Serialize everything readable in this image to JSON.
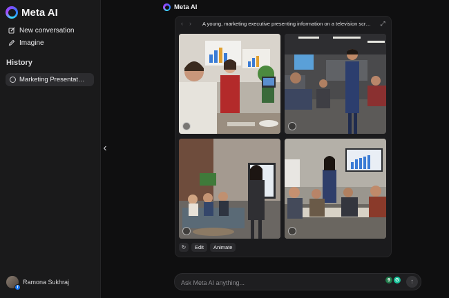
{
  "sidebar": {
    "brand": "Meta AI",
    "nav": [
      {
        "label": "New conversation",
        "icon": "edit-icon"
      },
      {
        "label": "Imagine",
        "icon": "pencil-icon"
      }
    ],
    "history_title": "History",
    "history": [
      {
        "label": "Marketing Presentat…",
        "icon": "chat-bubble-icon"
      }
    ],
    "user": {
      "name": "Ramona Sukhraj",
      "badge": "f"
    }
  },
  "header": {
    "name": "Meta AI"
  },
  "card": {
    "prompt": "A young, marketing executive presenting information on a television scr…",
    "prev_symbol": "‹",
    "next_symbol": "›",
    "expand_symbol": "⤢",
    "actions": {
      "regenerate_symbol": "↻",
      "edit": "Edit",
      "animate": "Animate"
    },
    "images": [
      {
        "alt": "woman in red blazer presenting charts"
      },
      {
        "alt": "man presenting in open office"
      },
      {
        "alt": "woman presenting to seated group"
      },
      {
        "alt": "woman presenting bar chart on screen"
      }
    ]
  },
  "composer": {
    "placeholder": "Ask Meta AI anything...",
    "send_symbol": "↑",
    "ext_left": "9",
    "ext_right": "G"
  },
  "colors": {
    "accent": "#7c4dff",
    "bg": "#0f0f10",
    "sidebar": "#1a1a1b",
    "grammarly": "#15c39a"
  }
}
